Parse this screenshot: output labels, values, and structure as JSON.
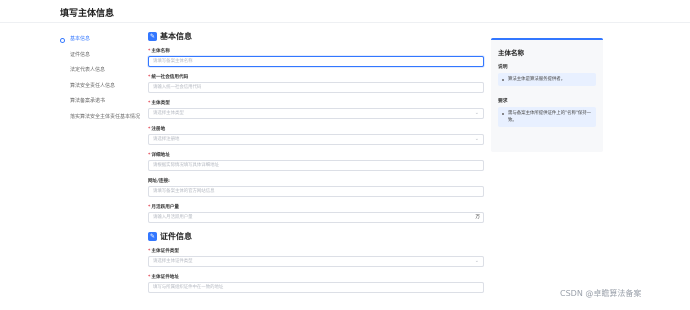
{
  "page": {
    "title": "填写主体信息"
  },
  "nav": {
    "items": [
      {
        "label": "基本信息",
        "active": true
      },
      {
        "label": "证件信息",
        "active": false
      },
      {
        "label": "法定代表人信息",
        "active": false
      },
      {
        "label": "算法安全责任人信息",
        "active": false
      },
      {
        "label": "算法备案承诺书",
        "active": false
      },
      {
        "label": "落实算法安全主体责任基本情况",
        "active": false
      }
    ]
  },
  "sections": {
    "basic": {
      "title": "基本信息",
      "fields": [
        {
          "label": "主体名称",
          "required": true,
          "placeholder": "请填写备案主体名称"
        },
        {
          "label": "统一社会信用代码",
          "required": true,
          "placeholder": "请输入统一社会信用代码"
        },
        {
          "label": "主体类型",
          "required": true,
          "placeholder": "请选择主体类型"
        },
        {
          "label": "注册地",
          "required": true,
          "placeholder": "请选择注册地"
        },
        {
          "label": "详细地址",
          "required": true,
          "placeholder": "请根据实际情况填写具体详细地址"
        },
        {
          "label": "网址/连接:",
          "required": false,
          "placeholder": "请填写备案主体的官方网站信息"
        },
        {
          "label": "月活跃用户量",
          "required": true,
          "placeholder": "请输入月活跃用户量",
          "suffix": "万"
        }
      ]
    },
    "cert": {
      "title": "证件信息",
      "fields": [
        {
          "label": "主体证件类型",
          "required": true,
          "placeholder": "请选择主体证件类型"
        },
        {
          "label": "主体证件地址",
          "required": true,
          "placeholder": "填写与所属组织证件中在一致的地址"
        }
      ]
    }
  },
  "aside": {
    "title": "主体名称",
    "desc_label": "说明",
    "desc_text": "算法主体是算法服务提供者。",
    "req_label": "要求",
    "req_text": "需与备案主体所提供证件上的\"名称\"保持一致。"
  },
  "watermark": "CSDN @卓瞻算法备案",
  "colors": {
    "accent": "#3377ff",
    "required": "#e34d59"
  }
}
